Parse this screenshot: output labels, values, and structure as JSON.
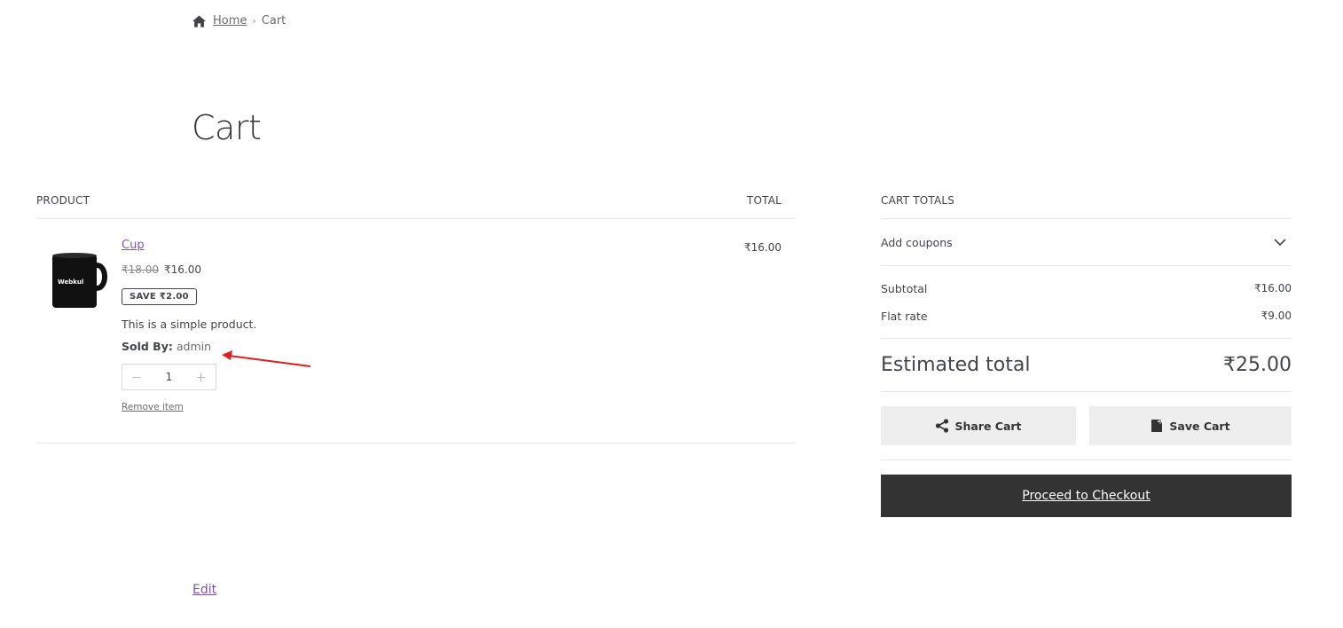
{
  "breadcrumb": {
    "home": "Home",
    "separator": "›",
    "current": "Cart"
  },
  "page": {
    "title": "Cart"
  },
  "table": {
    "col_product": "Product",
    "col_total": "Total"
  },
  "item": {
    "name": "Cup",
    "regular_price": "₹18.00",
    "sale_price": "₹16.00",
    "save_badge": "SAVE ₹2.00",
    "description": "This is a simple product.",
    "sold_by_label": "Sold By:",
    "sold_by_value": "admin",
    "quantity": "1",
    "quantity_minus": "−",
    "quantity_plus": "+",
    "remove_label": "Remove item",
    "line_total": "₹16.00",
    "thumb_brand": "Webkul"
  },
  "totals": {
    "heading": "Cart totals",
    "add_coupons": "Add coupons",
    "subtotal_label": "Subtotal",
    "subtotal_value": "₹16.00",
    "shipping_label": "Flat rate",
    "shipping_value": "₹9.00",
    "estimated_label": "Estimated total",
    "estimated_value": "₹25.00",
    "share_cart": "Share Cart",
    "save_cart": "Save Cart",
    "checkout": "Proceed to Checkout"
  },
  "footer": {
    "edit": "Edit"
  },
  "colors": {
    "accent": "#7f54b3",
    "dark": "#333333",
    "arrow": "#e02020"
  }
}
